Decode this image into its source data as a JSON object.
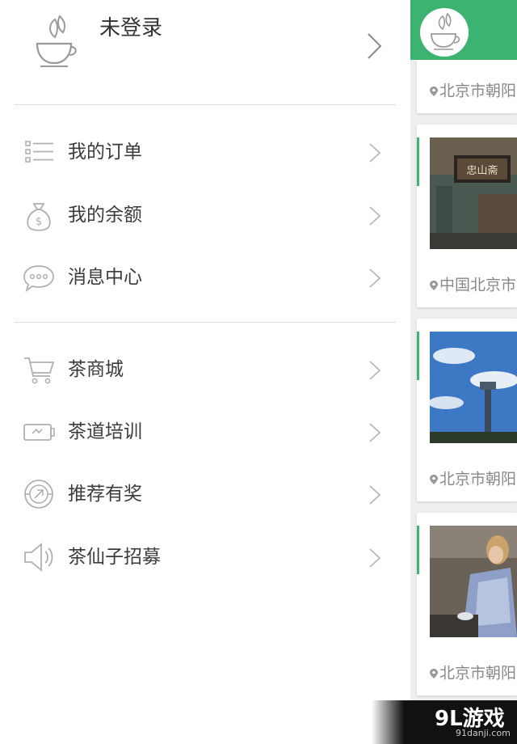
{
  "drawer": {
    "profile": {
      "username": "未登录",
      "avatar_icon": "teacup-avatar-icon"
    },
    "group1": [
      {
        "label": "我的订单",
        "icon": "list-icon"
      },
      {
        "label": "我的余额",
        "icon": "money-bag-icon"
      },
      {
        "label": "消息中心",
        "icon": "chat-bubble-icon"
      }
    ],
    "group2": [
      {
        "label": "茶商城",
        "icon": "cart-icon"
      },
      {
        "label": "茶道培训",
        "icon": "battery-icon"
      },
      {
        "label": "推荐有奖",
        "icon": "gift-coin-icon"
      },
      {
        "label": "茶仙子招募",
        "icon": "speaker-icon"
      }
    ]
  },
  "feed": {
    "header_color": "#3cb371",
    "cards": [
      {
        "location": "北京市朝阳"
      },
      {
        "location": "中国北京市"
      },
      {
        "location": "北京市朝阳"
      },
      {
        "location": "北京市朝阳"
      }
    ]
  },
  "watermark": {
    "logo": "9L游戏",
    "url": "91danji.com"
  }
}
